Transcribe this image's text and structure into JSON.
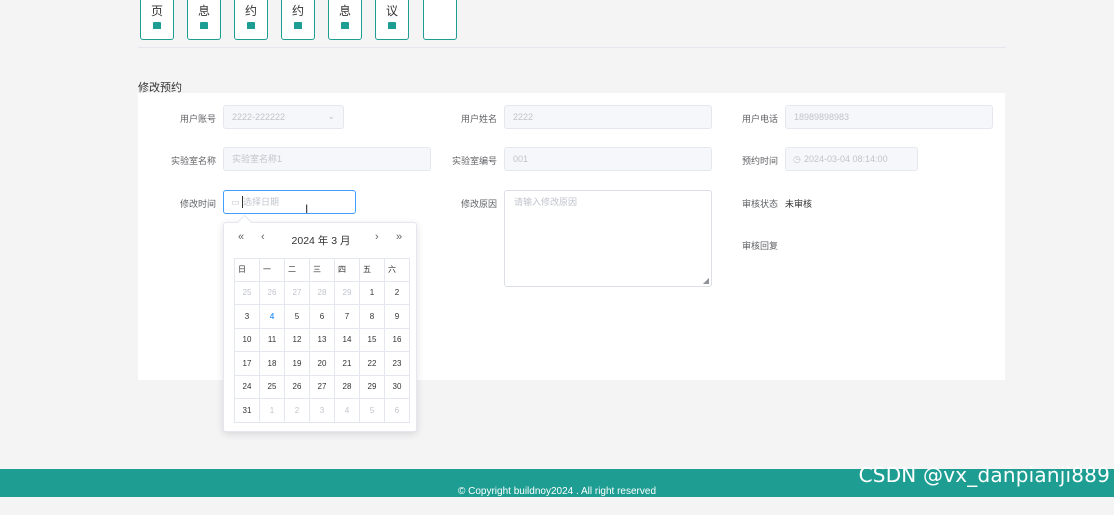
{
  "nav": {
    "tiles": [
      {
        "text": "页"
      },
      {
        "text": "息"
      },
      {
        "text": "约"
      },
      {
        "text": "约"
      },
      {
        "text": "息"
      },
      {
        "text": "议"
      },
      {
        "text": ""
      }
    ]
  },
  "section_title": "修改预约",
  "form": {
    "user_account": {
      "label": "用户账号",
      "value": "2222-222222"
    },
    "user_name": {
      "label": "用户姓名",
      "value": "2222"
    },
    "user_phone": {
      "label": "用户电话",
      "value": "18989898983"
    },
    "lab_name": {
      "label": "实验室名称",
      "placeholder": "实验室名称1"
    },
    "lab_code": {
      "label": "实验室编号",
      "value": "001"
    },
    "reserve_time": {
      "label": "预约时间",
      "value": "2024-03-04 08:14:00"
    },
    "modify_time": {
      "label": "修改时间",
      "placeholder": "选择日期"
    },
    "modify_reason": {
      "label": "修改原因",
      "placeholder": "请输入修改原因"
    },
    "review_status": {
      "label": "审核状态",
      "value": "未审核"
    },
    "review_reply": {
      "label": "审核回复"
    }
  },
  "datepicker": {
    "title": "2024 年  3 月",
    "prev_year": "«",
    "prev_month": "‹",
    "next_month": "›",
    "next_year": "»",
    "weekdays": [
      "日",
      "一",
      "二",
      "三",
      "四",
      "五",
      "六"
    ],
    "weeks": [
      [
        "25",
        "26",
        "27",
        "28",
        "29",
        "1",
        "2"
      ],
      [
        "3",
        "4",
        "5",
        "6",
        "7",
        "8",
        "9"
      ],
      [
        "10",
        "11",
        "12",
        "13",
        "14",
        "15",
        "16"
      ],
      [
        "17",
        "18",
        "19",
        "20",
        "21",
        "22",
        "23"
      ],
      [
        "24",
        "25",
        "26",
        "27",
        "28",
        "29",
        "30"
      ],
      [
        "31",
        "1",
        "2",
        "3",
        "4",
        "5",
        "6"
      ]
    ],
    "today": "4",
    "accent_color": "#409eff"
  },
  "footer": {
    "text": "© Copyright buildnoy2024 . All right reserved"
  },
  "watermark": "CSDN @vx_danpianji889",
  "colors": {
    "brand": "#1e9e92",
    "accent": "#409eff"
  }
}
